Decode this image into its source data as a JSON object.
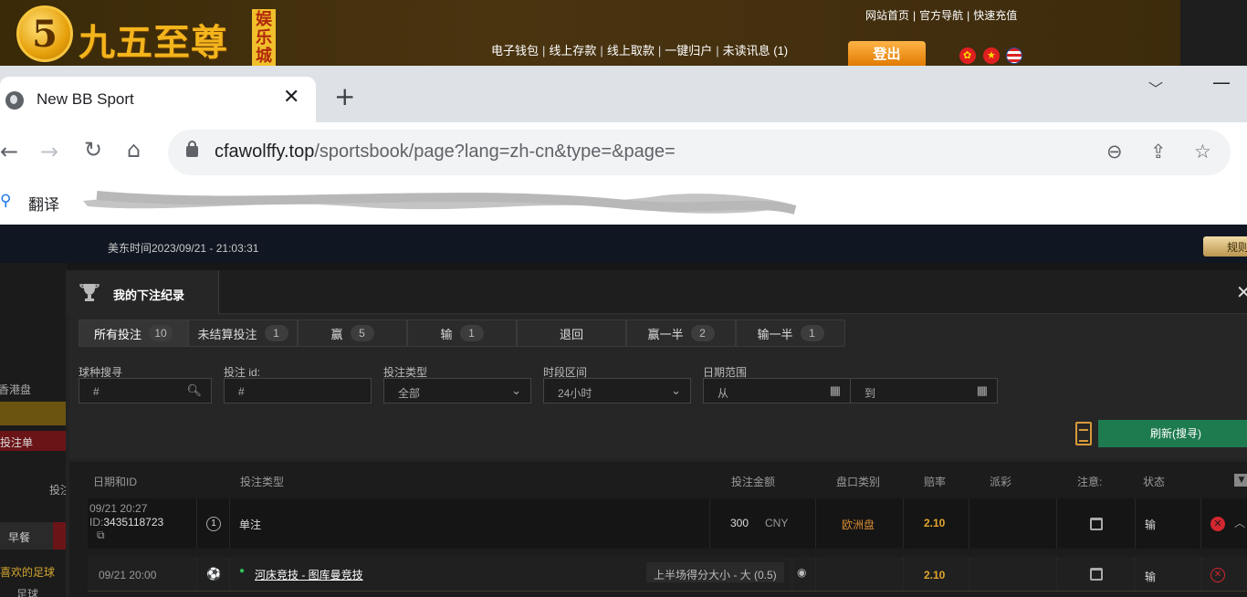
{
  "site": {
    "logo_digit": "5",
    "logo_text": "九五至尊",
    "logo_badge": "娱乐城",
    "top_links": [
      "网站首页",
      "官方导航",
      "快速充值"
    ],
    "main_links": [
      "电子钱包",
      "线上存款",
      "线上取款",
      "一键归户",
      "未读讯息 (1)"
    ],
    "logout": "登出",
    "colors": {
      "gold": "#f3b41c",
      "logout": "#f09a20"
    }
  },
  "browser": {
    "tab_title": "New BB Sport",
    "tab_close": "✕",
    "new_tab": "+",
    "url_domain": "cfawolffy.top",
    "url_path": "/sportsbook/page?lang=zh-cn&type=&page=",
    "bookmark_translate": "翻译"
  },
  "page": {
    "clock": "美东时间2023/09/21 - 21:03:31",
    "rules_button": "规则",
    "sidebar": [
      "香港盘",
      "投注单",
      "投注",
      "早餐",
      "喜欢的足球",
      "足球"
    ]
  },
  "modal": {
    "title": "我的下注纪录",
    "close": "✕",
    "tabs": [
      {
        "label": "所有投注",
        "count": "10"
      },
      {
        "label": "未结算投注",
        "count": "1"
      },
      {
        "label": "赢",
        "count": "5"
      },
      {
        "label": "输",
        "count": "1"
      },
      {
        "label": "退回",
        "count": ""
      },
      {
        "label": "赢一半",
        "count": "2"
      },
      {
        "label": "输一半",
        "count": "1"
      }
    ],
    "filters": {
      "sport_label": "球种搜寻",
      "sport_placeholder": "#",
      "betid_label": "投注 id:",
      "betid_placeholder": "#",
      "type_label": "投注类型",
      "type_value": "全部",
      "period_label": "时段区间",
      "period_value": "24小时",
      "date_label": "日期范围",
      "date_from": "从",
      "date_to": "到"
    },
    "refresh": "刷新(搜寻)",
    "columns": [
      "日期和ID",
      "投注类型",
      "投注金额",
      "盘口类别",
      "赔率",
      "派彩",
      "注意:",
      "状态"
    ],
    "rows": [
      {
        "date": "09/21 20:27",
        "id_prefix": "ID:",
        "id": "3435118723",
        "legs": "1",
        "type": "单注",
        "amount": "300",
        "currency": "CNY",
        "market": "欧洲盘",
        "odds": "2.10",
        "status": "输"
      }
    ],
    "legs": [
      {
        "date": "09/21 20:00",
        "match": "河床竞技 - 图库曼竞技",
        "selection": "上半场得分大小 - 大 (0.5)",
        "odds": "2.10",
        "status": "输"
      }
    ]
  }
}
